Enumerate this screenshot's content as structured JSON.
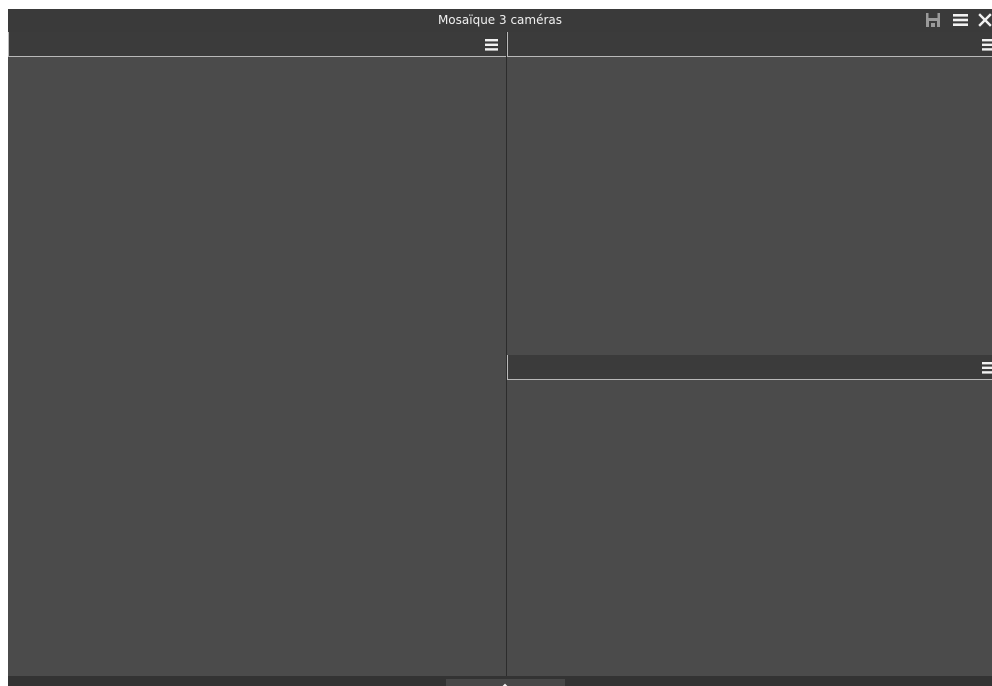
{
  "window": {
    "title": "Mosaïque 3 caméras"
  },
  "titlebar": {
    "icons": [
      "save-icon",
      "menu-icon",
      "close-icon"
    ]
  },
  "panes": [
    {
      "id": "camera-1",
      "menu_icon": "menu-icon"
    },
    {
      "id": "camera-2",
      "menu_icon": "menu-icon"
    },
    {
      "id": "camera-3",
      "menu_icon": "menu-icon"
    }
  ],
  "colors": {
    "window_bg": "#3b3b3b",
    "pane_bg": "#4b4b4b",
    "header_border": "#b9b9b9",
    "text": "#f0f0f0"
  }
}
